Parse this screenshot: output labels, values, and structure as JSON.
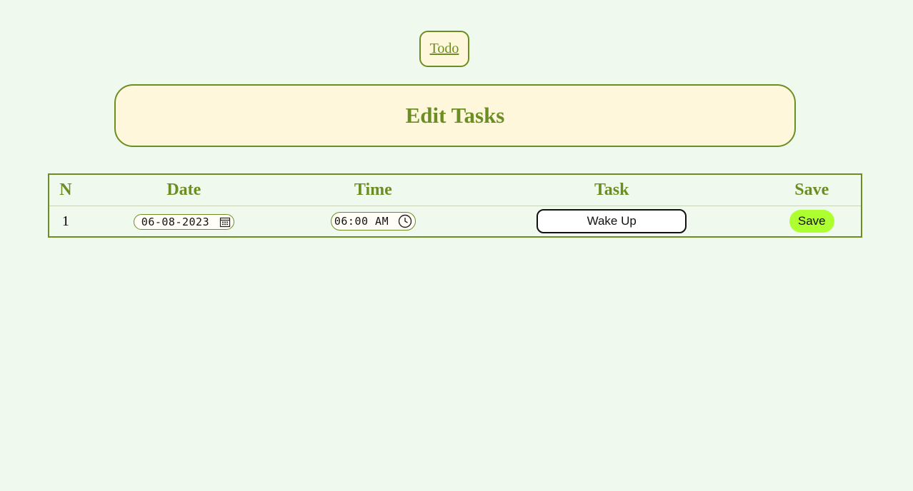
{
  "nav": {
    "todo_link": "Todo"
  },
  "header": {
    "title": "Edit Tasks"
  },
  "table": {
    "columns": [
      "N",
      "Date",
      "Time",
      "Task",
      "Save"
    ],
    "rows": [
      {
        "n": "1",
        "date": "06-08-2023",
        "time": "06:00 AM",
        "task": "Wake Up",
        "save_label": "Save"
      }
    ]
  },
  "colors": {
    "background": "#f0f9ee",
    "accent": "#6b8e23",
    "panel": "#fff7dc",
    "save_button": "#adff2f"
  },
  "icons": {
    "date_picker": "calendar-icon",
    "time_picker": "clock-icon"
  }
}
